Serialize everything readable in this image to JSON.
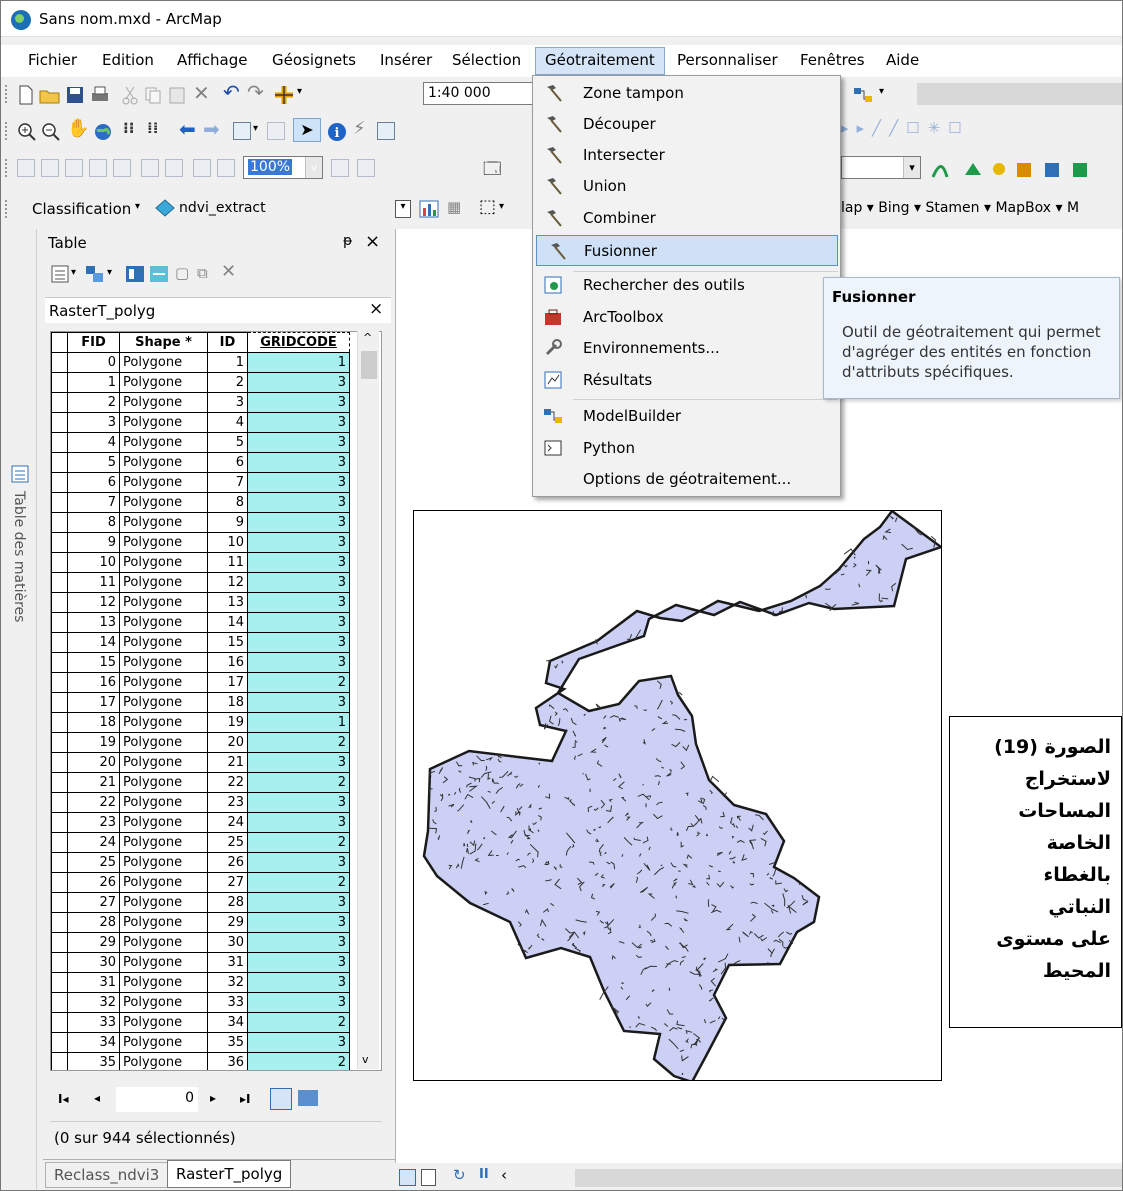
{
  "window": {
    "title": "Sans nom.mxd - ArcMap"
  },
  "menubar": {
    "items": [
      "Fichier",
      "Edition",
      "Affichage",
      "Géosignets",
      "Insérer",
      "Sélection",
      "Géotraitement",
      "Personnaliser",
      "Fenêtres",
      "Aide"
    ],
    "active": "Géotraitement"
  },
  "toolbar": {
    "scale_value": "1:40 000",
    "zoom_value": "100%",
    "classification_label": "Classification",
    "layer_value": "ndvi_extract",
    "basemaps": "lap ▾  Bing ▾  Stamen ▾  MapBox ▾  M"
  },
  "geoprocessing_menu": {
    "items": [
      {
        "label": "Zone tampon",
        "icon": "hammer-icon"
      },
      {
        "label": "Découper",
        "icon": "hammer-icon"
      },
      {
        "label": "Intersecter",
        "icon": "hammer-icon"
      },
      {
        "label": "Union",
        "icon": "hammer-icon"
      },
      {
        "label": "Combiner",
        "icon": "hammer-icon"
      },
      {
        "label": "Fusionner",
        "icon": "hammer-icon",
        "highlighted": true
      },
      {
        "label": "Rechercher des outils",
        "icon": "search-tools-icon"
      },
      {
        "label": "ArcToolbox",
        "icon": "toolbox-icon"
      },
      {
        "label": "Environnements...",
        "icon": "wrench-icon"
      },
      {
        "label": "Résultats",
        "icon": "results-icon"
      },
      {
        "label": "ModelBuilder",
        "icon": "modelbuilder-icon"
      },
      {
        "label": "Python",
        "icon": "python-icon"
      },
      {
        "label": "Options de géotraitement...",
        "icon": ""
      }
    ]
  },
  "tooltip": {
    "title": "Fusionner",
    "text": "Outil de géotraitement qui permet d'agréger des entités en fonction d'attributs spécifiques."
  },
  "toc_tab": {
    "label": "Table des matières"
  },
  "table_window": {
    "title": "Table",
    "pin": "ᵽ",
    "close": "×",
    "tab_name": "RasterT_polyg",
    "columns": [
      "FID",
      "Shape *",
      "ID",
      "GRIDCODE"
    ],
    "rows": [
      [
        "0",
        "Polygone",
        "1",
        "1"
      ],
      [
        "1",
        "Polygone",
        "2",
        "3"
      ],
      [
        "2",
        "Polygone",
        "3",
        "3"
      ],
      [
        "3",
        "Polygone",
        "4",
        "3"
      ],
      [
        "4",
        "Polygone",
        "5",
        "3"
      ],
      [
        "5",
        "Polygone",
        "6",
        "3"
      ],
      [
        "6",
        "Polygone",
        "7",
        "3"
      ],
      [
        "7",
        "Polygone",
        "8",
        "3"
      ],
      [
        "8",
        "Polygone",
        "9",
        "3"
      ],
      [
        "9",
        "Polygone",
        "10",
        "3"
      ],
      [
        "10",
        "Polygone",
        "11",
        "3"
      ],
      [
        "11",
        "Polygone",
        "12",
        "3"
      ],
      [
        "12",
        "Polygone",
        "13",
        "3"
      ],
      [
        "13",
        "Polygone",
        "14",
        "3"
      ],
      [
        "14",
        "Polygone",
        "15",
        "3"
      ],
      [
        "15",
        "Polygone",
        "16",
        "3"
      ],
      [
        "16",
        "Polygone",
        "17",
        "2"
      ],
      [
        "17",
        "Polygone",
        "18",
        "3"
      ],
      [
        "18",
        "Polygone",
        "19",
        "1"
      ],
      [
        "19",
        "Polygone",
        "20",
        "2"
      ],
      [
        "20",
        "Polygone",
        "21",
        "3"
      ],
      [
        "21",
        "Polygone",
        "22",
        "2"
      ],
      [
        "22",
        "Polygone",
        "23",
        "3"
      ],
      [
        "23",
        "Polygone",
        "24",
        "3"
      ],
      [
        "24",
        "Polygone",
        "25",
        "2"
      ],
      [
        "25",
        "Polygone",
        "26",
        "3"
      ],
      [
        "26",
        "Polygone",
        "27",
        "2"
      ],
      [
        "27",
        "Polygone",
        "28",
        "3"
      ],
      [
        "28",
        "Polygone",
        "29",
        "3"
      ],
      [
        "29",
        "Polygone",
        "30",
        "3"
      ],
      [
        "30",
        "Polygone",
        "31",
        "3"
      ],
      [
        "31",
        "Polygone",
        "32",
        "3"
      ],
      [
        "32",
        "Polygone",
        "33",
        "3"
      ],
      [
        "33",
        "Polygone",
        "34",
        "2"
      ],
      [
        "34",
        "Polygone",
        "35",
        "3"
      ],
      [
        "35",
        "Polygone",
        "36",
        "2"
      ]
    ],
    "record_value": "0",
    "status": "(0 sur 944 sélectionnés)",
    "bottom_tabs": [
      "Reclass_ndvi3",
      "RasterT_polyg"
    ]
  },
  "caption": {
    "lines": [
      "الصورة (19)",
      "لاستخراج",
      "المساحات",
      "الخاصة",
      "بالغطاء النباتي",
      "على مستوى",
      "المحيط"
    ]
  },
  "colors": {
    "polygon_fill": "#ccd0f5",
    "gridcode_highlight": "#a8f0f0",
    "menu_highlight": "#cfe1f7"
  }
}
